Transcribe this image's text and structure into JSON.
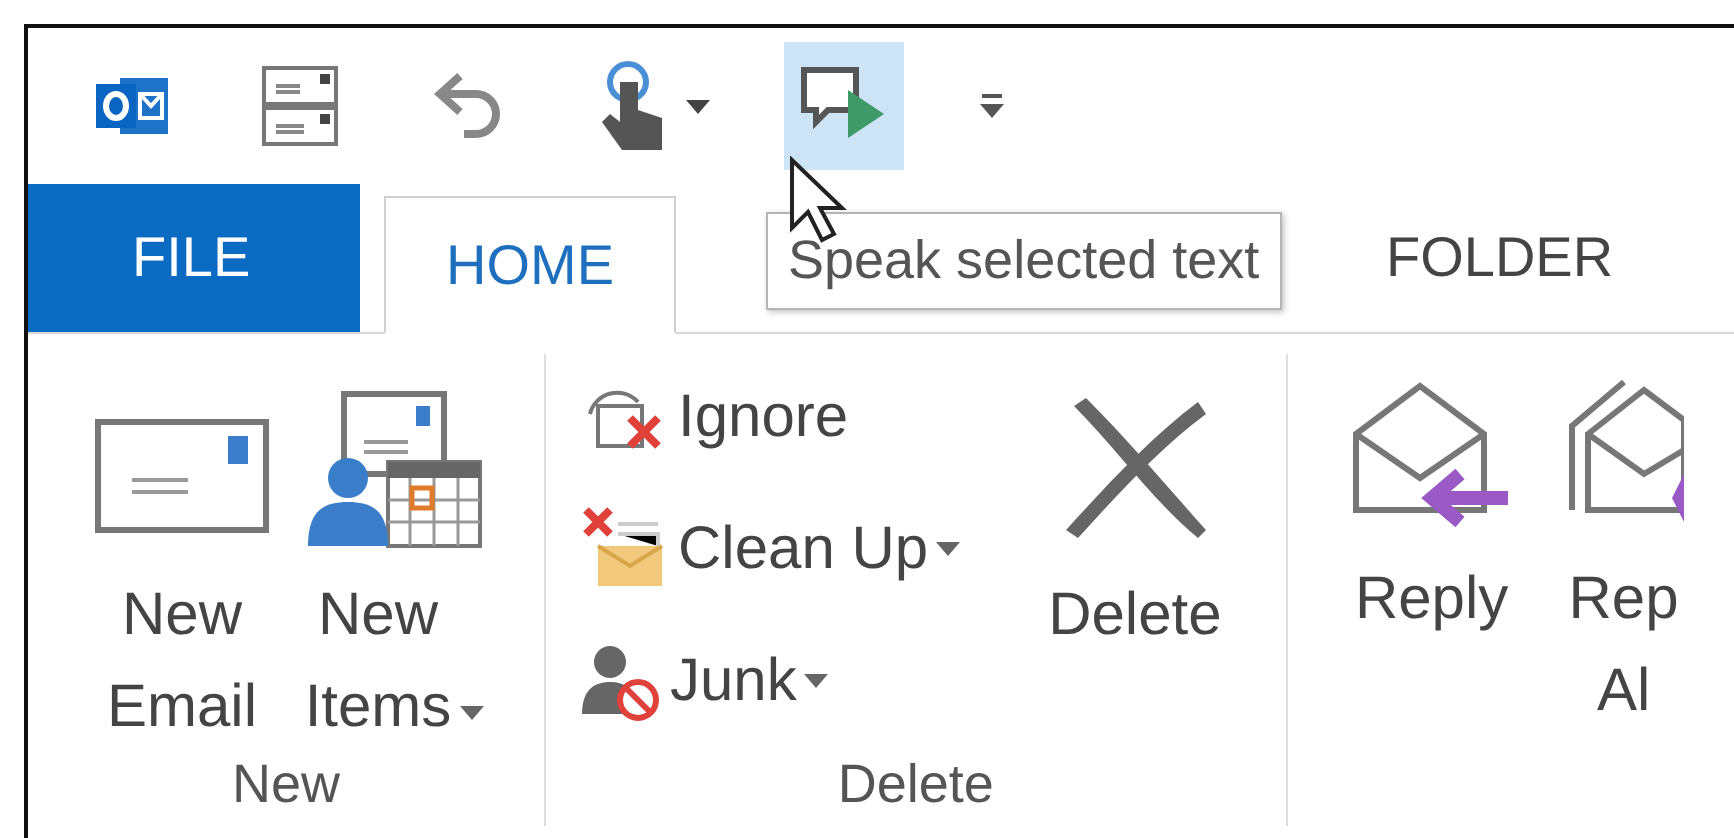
{
  "quick_access": [
    {
      "kind": "outlook",
      "hovered": false
    },
    {
      "kind": "compose",
      "hovered": false
    },
    {
      "kind": "undo",
      "hovered": false
    },
    {
      "kind": "touch",
      "hovered": false
    },
    {
      "kind": "caret",
      "hovered": false
    },
    {
      "kind": "speak",
      "hovered": true
    },
    {
      "kind": "customize",
      "hovered": false
    }
  ],
  "tooltip": {
    "text": "Speak selected text"
  },
  "tabs": [
    {
      "label": "FILE",
      "kind": "file",
      "selected": false
    },
    {
      "label": "HOME",
      "kind": "tab",
      "selected": true
    },
    {
      "label": "FOLDER",
      "kind": "tab",
      "selected": false
    }
  ],
  "groups": [
    {
      "label": "New",
      "items": [
        {
          "kind": "large",
          "label": "New\nEmail",
          "dropdown": false
        },
        {
          "kind": "large",
          "label": "New\nItems",
          "dropdown": true
        }
      ]
    },
    {
      "label": "Delete",
      "items": [
        {
          "kind": "stack",
          "items": [
            {
              "label": "Ignore",
              "dropdown": false
            },
            {
              "label": "Clean Up",
              "dropdown": true
            },
            {
              "label": "Junk",
              "dropdown": true
            }
          ]
        },
        {
          "kind": "large",
          "label": "Delete",
          "dropdown": false
        }
      ]
    },
    {
      "items": [
        {
          "kind": "large",
          "label": "Reply",
          "dropdown": false
        },
        {
          "kind": "large",
          "label": "Rep\nAl",
          "dropdown": false
        }
      ]
    }
  ]
}
